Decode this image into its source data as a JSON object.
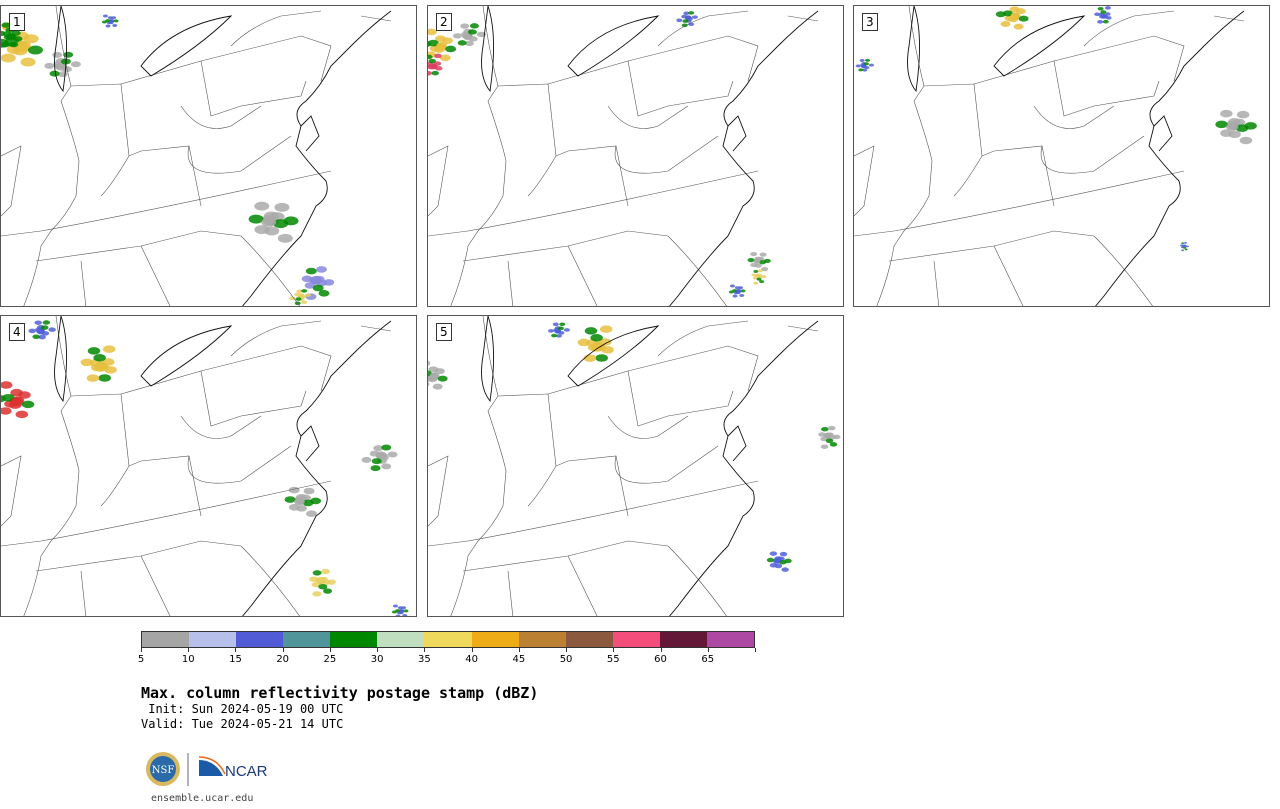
{
  "panels": [
    {
      "label": "1",
      "storms": [
        [
          20,
          40,
          30,
          "#e8c040"
        ],
        [
          10,
          30,
          18,
          "#008800"
        ],
        [
          60,
          60,
          20,
          "#aaaaaa"
        ],
        [
          270,
          215,
          30,
          "#aaaaaa"
        ],
        [
          315,
          275,
          22,
          "#8888dd"
        ],
        [
          300,
          290,
          12,
          "#e8d060"
        ],
        [
          110,
          15,
          10,
          "#5060d8"
        ]
      ]
    },
    {
      "label": "2",
      "storms": [
        [
          12,
          40,
          22,
          "#e8c040"
        ],
        [
          5,
          60,
          15,
          "#dd4060"
        ],
        [
          40,
          30,
          18,
          "#aaaaaa"
        ],
        [
          330,
          255,
          14,
          "#aaaaaa"
        ],
        [
          330,
          270,
          10,
          "#e8d060"
        ],
        [
          260,
          12,
          12,
          "#5060d8"
        ],
        [
          310,
          285,
          10,
          "#5060d8"
        ]
      ]
    },
    {
      "label": "3",
      "storms": [
        [
          160,
          10,
          20,
          "#e8c040"
        ],
        [
          250,
          10,
          12,
          "#5060d8"
        ],
        [
          10,
          60,
          10,
          "#5060d8"
        ],
        [
          380,
          120,
          25,
          "#aaaaaa"
        ],
        [
          330,
          240,
          6,
          "#5060d8"
        ]
      ]
    },
    {
      "label": "4",
      "storms": [
        [
          15,
          85,
          25,
          "#dd3030"
        ],
        [
          100,
          50,
          25,
          "#e8c040"
        ],
        [
          40,
          15,
          15,
          "#5060d8"
        ],
        [
          300,
          185,
          22,
          "#aaaaaa"
        ],
        [
          320,
          265,
          18,
          "#e8d060"
        ],
        [
          380,
          140,
          20,
          "#aaaaaa"
        ],
        [
          400,
          295,
          10,
          "#5060d8"
        ]
      ]
    },
    {
      "label": "5",
      "storms": [
        [
          5,
          60,
          20,
          "#aaaaaa"
        ],
        [
          170,
          30,
          25,
          "#e8c040"
        ],
        [
          130,
          15,
          12,
          "#5060d8"
        ],
        [
          350,
          245,
          15,
          "#5060d8"
        ],
        [
          400,
          120,
          15,
          "#aaaaaa"
        ]
      ]
    }
  ],
  "chart_data": {
    "type": "heatmap",
    "title": "Max. column reflectivity postage stamp (dBZ)",
    "init": " Init: Sun 2024-05-19 00 UTC",
    "valid": "Valid: Tue 2024-05-21 14 UTC",
    "colorbar": {
      "ticks": [
        "5",
        "10",
        "15",
        "20",
        "25",
        "30",
        "35",
        "40",
        "45",
        "50",
        "55",
        "60",
        "65"
      ],
      "range": [
        5,
        70
      ],
      "colors": [
        "#a5a5a5",
        "#b6c0eb",
        "#515bd6",
        "#4f9599",
        "#008700",
        "#bfdfc0",
        "#eed95c",
        "#eeac17",
        "#bb8031",
        "#8b5a3e",
        "#f44f7c",
        "#631837",
        "#ad48a3"
      ]
    }
  },
  "footer": {
    "site": "ensemble.ucar.edu",
    "logo_nsf": "NSF",
    "logo_ncar": "NCAR"
  }
}
